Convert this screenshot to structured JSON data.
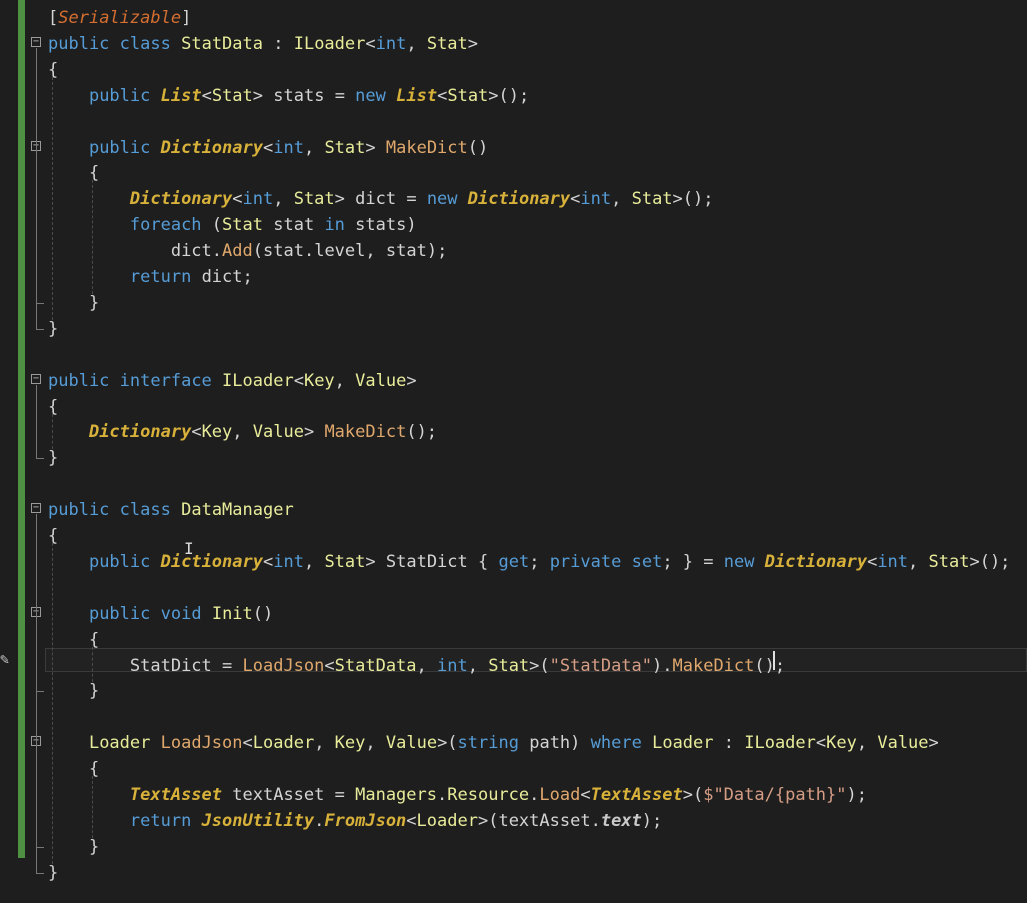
{
  "editor": {
    "language": "C#",
    "lines": [
      {
        "text": "[Serializable]"
      },
      {
        "text": "public class StatData : ILoader<int, Stat>",
        "fold": true
      },
      {
        "text": "{"
      },
      {
        "text": "    public List<Stat> stats = new List<Stat>();"
      },
      {
        "text": ""
      },
      {
        "text": "    public Dictionary<int, Stat> MakeDict()",
        "fold": true
      },
      {
        "text": "    {"
      },
      {
        "text": "        Dictionary<int, Stat> dict = new Dictionary<int, Stat>();"
      },
      {
        "text": "        foreach (Stat stat in stats)"
      },
      {
        "text": "            dict.Add(stat.level, stat);"
      },
      {
        "text": "        return dict;"
      },
      {
        "text": "    }"
      },
      {
        "text": "}"
      },
      {
        "text": ""
      },
      {
        "text": "public interface ILoader<Key, Value>",
        "fold": true
      },
      {
        "text": "{"
      },
      {
        "text": "    Dictionary<Key, Value> MakeDict();"
      },
      {
        "text": "}"
      },
      {
        "text": ""
      },
      {
        "text": "public class DataManager",
        "fold": true
      },
      {
        "text": "{"
      },
      {
        "text": "    public Dictionary<int, Stat> StatDict { get; private set; } = new Dictionary<int, Stat>();"
      },
      {
        "text": ""
      },
      {
        "text": "    public void Init()",
        "fold": true
      },
      {
        "text": "    {"
      },
      {
        "text": "        StatDict = LoadJson<StatData, int, Stat>(\"StatData\").MakeDict();",
        "current": true
      },
      {
        "text": "    }"
      },
      {
        "text": ""
      },
      {
        "text": "    Loader LoadJson<Loader, Key, Value>(string path) where Loader : ILoader<Key, Value>",
        "fold": true
      },
      {
        "text": "    {"
      },
      {
        "text": "        TextAsset textAsset = Managers.Resource.Load<TextAsset>($\"Data/{path}\");"
      },
      {
        "text": "        return JsonUtility.FromJson<Loader>(textAsset.text);"
      },
      {
        "text": "    }"
      },
      {
        "text": "}"
      }
    ],
    "fold_symbol": "−",
    "colors": {
      "background": "#1e1e1e",
      "keyword": "#569cd6",
      "type": "#e8ec9a",
      "italic_type": "#d7b13a",
      "method": "#e0a86d",
      "string": "#d69d85",
      "change_bar": "#57a64a"
    },
    "icons": [
      "pencil-icon",
      "collapse-icon",
      "text-cursor-icon"
    ]
  }
}
